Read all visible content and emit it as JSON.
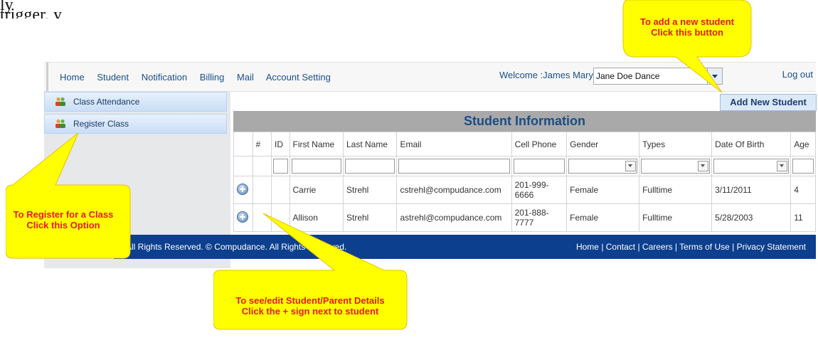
{
  "top_clip_text": "ly trigger, y",
  "nav": {
    "items": [
      "Home",
      "Student",
      "Notification",
      "Billing",
      "Mail",
      "Account Setting"
    ],
    "welcome": "Welcome :James Mary",
    "school_select_value": "Jane Doe Dance",
    "logout": "Log out"
  },
  "sidebar": {
    "items": [
      {
        "label": "Class Attendance",
        "icon": "people-icon"
      },
      {
        "label": "Register Class",
        "icon": "people-icon"
      }
    ]
  },
  "add_button": "Add New Student",
  "table": {
    "title": "Student Information",
    "columns": [
      "",
      "#",
      "ID",
      "First Name",
      "Last Name",
      "Email",
      "Cell Phone",
      "Gender",
      "Types",
      "Date Of Birth",
      "Age"
    ],
    "rows": [
      {
        "first": "Carrie",
        "last": "Strehl",
        "email": "cstrehl@compudance.com",
        "phone": "201-999-6666",
        "gender": "Female",
        "type": "Fulltime",
        "dob": "3/11/2011",
        "age": "4"
      },
      {
        "first": "Allison",
        "last": "Strehl",
        "email": "astrehl@compudance.com",
        "phone": "201-888-7777",
        "gender": "Female",
        "type": "Fulltime",
        "dob": "5/28/2003",
        "age": "11"
      }
    ]
  },
  "footer": {
    "copyright": "All Rights Reserved. © Compudance. All Rights Reserved.",
    "links": "Home | Contact | Careers | Terms of Use | Privacy Statement"
  },
  "callouts": {
    "add_student": {
      "line1": "To add a new student",
      "line2": "Click this button"
    },
    "register": {
      "line1": "To Register for a Class",
      "line2": "Click this Option"
    },
    "details": {
      "line1": "To see/edit Student/Parent Details",
      "line2": "Click the + sign next to student"
    }
  },
  "colors": {
    "callout_fill": "#ffff00",
    "callout_text": "#e41b1b",
    "footer": "#0d3f8f",
    "title": "#1c4c85"
  }
}
